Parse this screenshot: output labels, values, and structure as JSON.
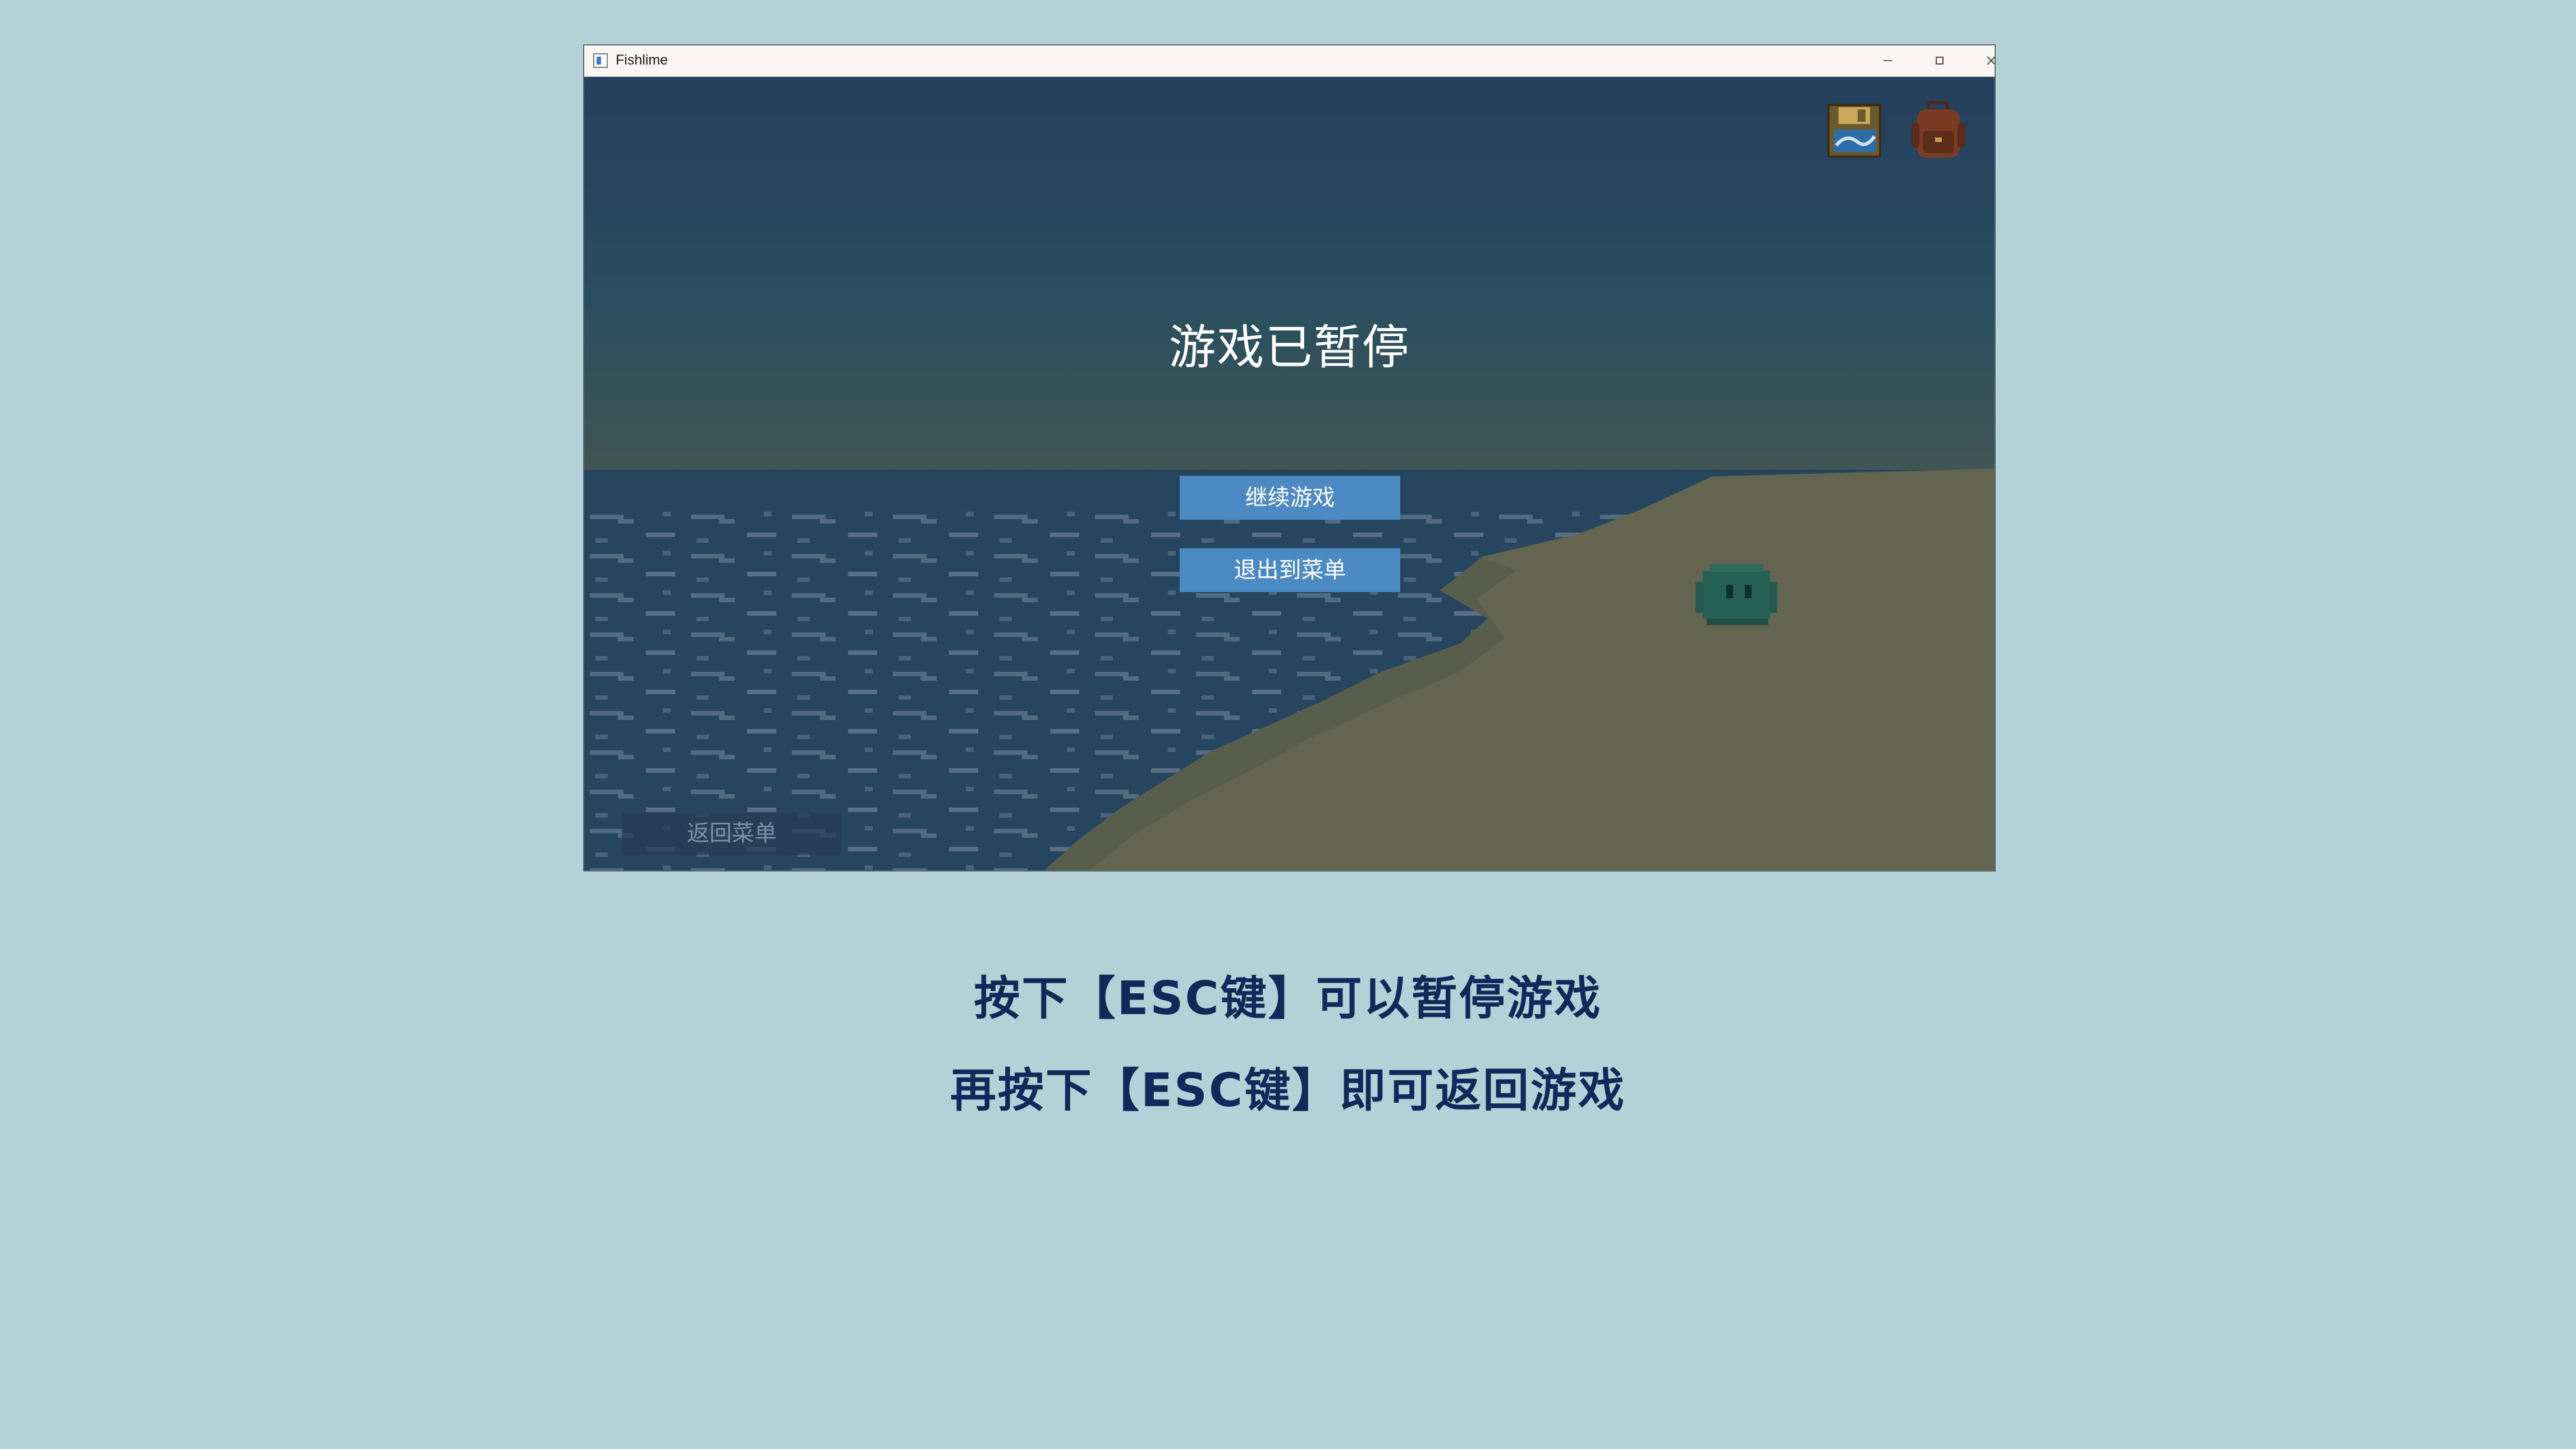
{
  "window": {
    "title": "Fishlime",
    "controls": [
      "minimize-icon",
      "maximize-icon",
      "close-icon"
    ]
  },
  "hud": {
    "icons": [
      "save-disk-icon",
      "backpack-icon"
    ]
  },
  "pause_menu": {
    "title": "游戏已暂停",
    "resume_label": "继续游戏",
    "exit_label": "退出到菜单"
  },
  "background_ui": {
    "back_to_menu_label": "返回菜单"
  },
  "captions": {
    "line1": "按下【ESC键】可以暂停游戏",
    "line2": "再按下【ESC键】即可返回游戏"
  },
  "colors": {
    "page_background": "#b3d1d6",
    "button_accent": "#4c8ac4",
    "caption_text": "#12285a",
    "sand": "#8f8152",
    "sea": "#2c4f6a"
  }
}
